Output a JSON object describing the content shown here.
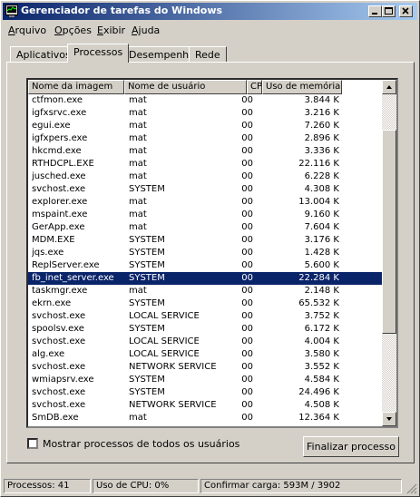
{
  "window": {
    "title": "Gerenciador de tarefas do Windows"
  },
  "menu": [
    {
      "first": "A",
      "rest": "rquivo"
    },
    {
      "first": "O",
      "rest": "pções"
    },
    {
      "first": "E",
      "rest": "xibir"
    },
    {
      "first": "Aj",
      "rest": "uda"
    }
  ],
  "tabs": [
    "Aplicativos",
    "Processos",
    "Desempenho",
    "Rede"
  ],
  "active_tab": "Processos",
  "table": {
    "columns": [
      "Nome da imagem",
      "Nome de usuário",
      "CPU",
      "Uso de memória"
    ],
    "rows": [
      [
        "ctfmon.exe",
        "mat",
        "00",
        "3.844 K"
      ],
      [
        "igfxsrvc.exe",
        "mat",
        "00",
        "3.216 K"
      ],
      [
        "egui.exe",
        "mat",
        "00",
        "7.260 K"
      ],
      [
        "igfxpers.exe",
        "mat",
        "00",
        "2.896 K"
      ],
      [
        "hkcmd.exe",
        "mat",
        "00",
        "3.336 K"
      ],
      [
        "RTHDCPL.EXE",
        "mat",
        "00",
        "22.116 K"
      ],
      [
        "jusched.exe",
        "mat",
        "00",
        "6.228 K"
      ],
      [
        "svchost.exe",
        "SYSTEM",
        "00",
        "4.308 K"
      ],
      [
        "explorer.exe",
        "mat",
        "00",
        "13.004 K"
      ],
      [
        "mspaint.exe",
        "mat",
        "00",
        "9.160 K"
      ],
      [
        "GerApp.exe",
        "mat",
        "00",
        "7.604 K"
      ],
      [
        "MDM.EXE",
        "SYSTEM",
        "00",
        "3.176 K"
      ],
      [
        "jqs.exe",
        "SYSTEM",
        "00",
        "1.428 K"
      ],
      [
        "ReplServer.exe",
        "SYSTEM",
        "00",
        "5.600 K"
      ],
      [
        "fb_inet_server.exe",
        "SYSTEM",
        "00",
        "22.284 K"
      ],
      [
        "taskmgr.exe",
        "mat",
        "00",
        "2.148 K"
      ],
      [
        "ekrn.exe",
        "SYSTEM",
        "00",
        "65.532 K"
      ],
      [
        "svchost.exe",
        "LOCAL SERVICE",
        "00",
        "3.752 K"
      ],
      [
        "spoolsv.exe",
        "SYSTEM",
        "00",
        "6.172 K"
      ],
      [
        "svchost.exe",
        "LOCAL SERVICE",
        "00",
        "4.004 K"
      ],
      [
        "alg.exe",
        "LOCAL SERVICE",
        "00",
        "3.580 K"
      ],
      [
        "svchost.exe",
        "NETWORK SERVICE",
        "00",
        "3.552 K"
      ],
      [
        "wmiapsrv.exe",
        "SYSTEM",
        "00",
        "4.584 K"
      ],
      [
        "svchost.exe",
        "SYSTEM",
        "00",
        "24.496 K"
      ],
      [
        "svchost.exe",
        "NETWORK SERVICE",
        "00",
        "4.508 K"
      ],
      [
        "SmDB.exe",
        "mat",
        "00",
        "12.364 K"
      ]
    ],
    "selected_row": 14
  },
  "show_all_label": "Mostrar processos de todos os usuários",
  "end_process_label": "Finalizar processo",
  "status": {
    "processes": "Processos: 41",
    "cpu": "Uso de CPU: 0%",
    "commit": "Confirmar carga: 593M / 3902"
  },
  "colors": {
    "title_start": "#0a246a",
    "title_end": "#a6caf0",
    "selection": "#0a246a",
    "face": "#d4d0c8"
  }
}
